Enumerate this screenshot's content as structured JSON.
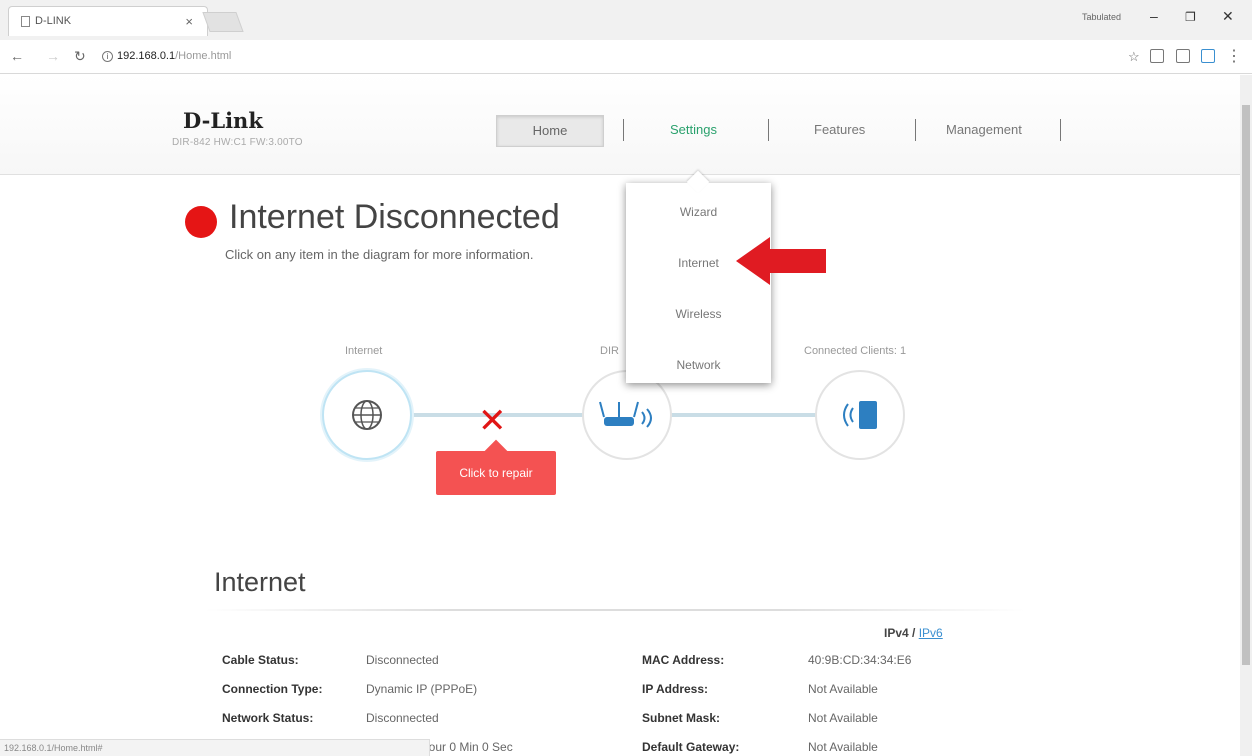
{
  "browser": {
    "tab_title": "D-LINK",
    "profile_name": "Tabulated",
    "url_host": "192.168.0.1",
    "url_path": "/Home.html",
    "status_url": "192.168.0.1/Home.html#"
  },
  "header": {
    "logo": "D-Link",
    "model": "DIR-842 HW:C1 FW:3.00TO",
    "nav": {
      "home": "Home",
      "settings": "Settings",
      "features": "Features",
      "management": "Management"
    }
  },
  "dropdown": {
    "items": [
      "Wizard",
      "Internet",
      "Wireless",
      "Network"
    ]
  },
  "status": {
    "title": "Internet Disconnected",
    "subtitle": "Click on any item in the diagram for more information.",
    "color": "#e51515"
  },
  "diagram": {
    "internet_label": "Internet",
    "router_label": "DIR",
    "clients_label": "Connected Clients: 1",
    "repair_label": "Click to repair"
  },
  "internet_section": {
    "title": "Internet",
    "ipv4": "IPv4",
    "slash": "/",
    "ipv6": "IPv6",
    "left_rows": [
      {
        "label": "Cable Status:",
        "value": "Disconnected"
      },
      {
        "label": "Connection Type:",
        "value": "Dynamic IP (PPPoE)"
      },
      {
        "label": "Network Status:",
        "value": "Disconnected"
      },
      {
        "label": "",
        "value": "Hour 0 Min 0 Sec"
      }
    ],
    "right_rows": [
      {
        "label": "MAC Address:",
        "value": "40:9B:CD:34:34:E6"
      },
      {
        "label": "IP Address:",
        "value": "Not Available"
      },
      {
        "label": "Subnet Mask:",
        "value": "Not Available"
      },
      {
        "label": "Default Gateway:",
        "value": "Not Available"
      }
    ]
  },
  "colors": {
    "accent_green": "#2aa16d",
    "repair_red": "#f45252",
    "arrow_red": "#e01b22",
    "link_blue": "#3a8fd0"
  }
}
